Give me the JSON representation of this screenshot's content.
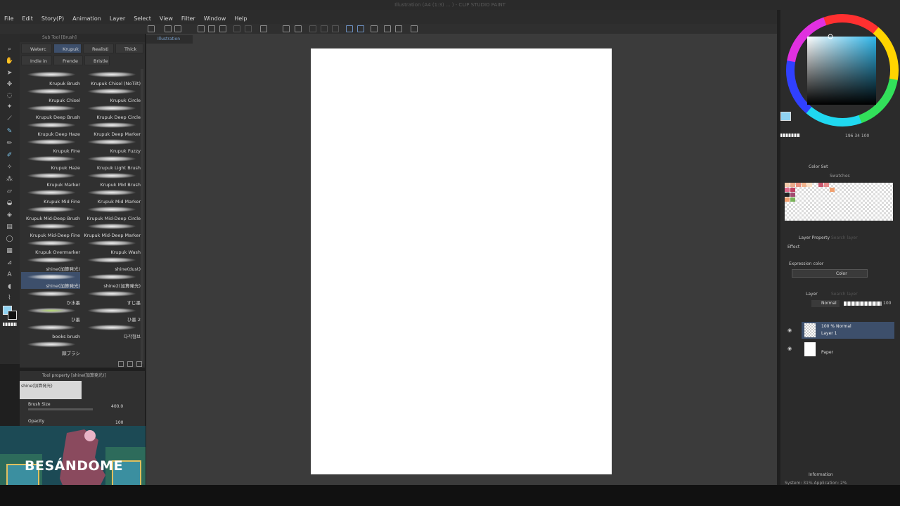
{
  "title": "Illustration (A4 (1:3) ... ) - CLIP STUDIO PAINT",
  "menu": [
    "File",
    "Edit",
    "Story(P)",
    "Animation",
    "Layer",
    "Select",
    "View",
    "Filter",
    "Window",
    "Help"
  ],
  "doc_tab": "Illustration",
  "subtool_header": "Sub Tool [Brush]",
  "subtool_tabs": [
    "Waterc",
    "Krupuk",
    "Realisti",
    "Thick",
    "Indie in",
    "Frende",
    "Bristle"
  ],
  "brushes": [
    "Krupuk Brush",
    "Krupuk Chisel (NoTilt)",
    "Krupuk Chisel",
    "Krupuk Circle",
    "Krupuk Deep Brush",
    "Krupuk Deep Circle",
    "Krupuk Deep Haze",
    "Krupuk Deep Marker",
    "Krupuk Fine",
    "Krupuk Fuzzy",
    "Krupuk Haze",
    "Krupuk Light Brush",
    "Krupuk Marker",
    "Krupuk Mid Brush",
    "Krupuk Mid Fine",
    "Krupuk Mid Marker",
    "Krupuk Mid-Deep Brush",
    "Krupuk Mid-Deep Circle",
    "Krupuk Mid-Deep Fine",
    "Krupuk Mid-Deep Marker",
    "Krupuk Overmarker",
    "Krupuk Wash",
    "shine(加算発光)",
    "shine(dust)",
    "shine(加算発光)",
    "shine2(加算発光)",
    "か水墨",
    "すじ墨",
    "ひ墨",
    "ひ墨 2",
    "books brush",
    "다각형브",
    "棘ブラシ",
    ""
  ],
  "tool_property": {
    "header": "Tool property [shine(加算発光)]",
    "preview_label": "shine(加算発光)",
    "brush_size_label": "Brush Size",
    "brush_size_value": "400.0",
    "opacity_label": "Opacity",
    "opacity_value": "100"
  },
  "webcam_text": "BESÁNDOME",
  "color_wheel": {
    "readout": "196 34 100",
    "current_color": "#8fd3f3"
  },
  "colorset": {
    "tab1": "Color Set",
    "tab2": "Swatches"
  },
  "layer_property": {
    "tab": "Layer Property",
    "tab2": "Search layer",
    "effect": "Effect",
    "expression_label": "Expression color",
    "expression_value": "Color"
  },
  "layer_panel": {
    "tab": "Layer",
    "tab2": "Search layer",
    "blend_mode": "Normal",
    "opacity": "100",
    "layers": [
      {
        "name": "Layer 1",
        "mode": "100 % Normal",
        "selected": true
      },
      {
        "name": "Paper",
        "mode": "",
        "selected": false
      }
    ]
  },
  "info": {
    "tab": "Information",
    "text": "System: 31%  Application: 2%"
  }
}
